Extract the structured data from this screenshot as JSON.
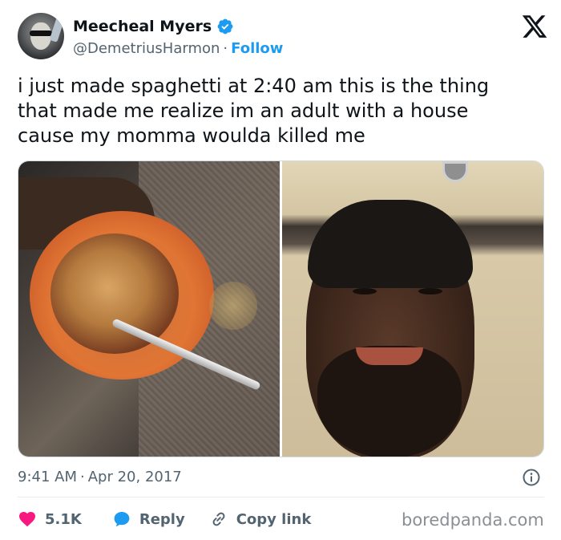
{
  "author": {
    "display_name": "Meecheal Myers",
    "handle": "@DemetriusHarmon",
    "separator": "·",
    "follow_label": "Follow",
    "verified_icon": "verified-badge-icon",
    "verified_color": "#1d9bf0"
  },
  "brand_icon": "x-logo-icon",
  "tweet": {
    "text": "i just made spaghetti at 2:40 am this is the thing\nthat made me realize im an adult with a house\ncause my momma woulda killed me"
  },
  "media": {
    "photo_count": 2
  },
  "meta": {
    "time": "9:41 AM",
    "separator": "·",
    "date": "Apr 20, 2017",
    "info_icon": "info-icon"
  },
  "actions": {
    "like_count": "5.1K",
    "like_color": "#f91880",
    "reply_label": "Reply",
    "reply_color": "#1d9bf0",
    "copy_label": "Copy link",
    "copy_icon": "link-icon"
  },
  "watermark": "boredpanda.com"
}
